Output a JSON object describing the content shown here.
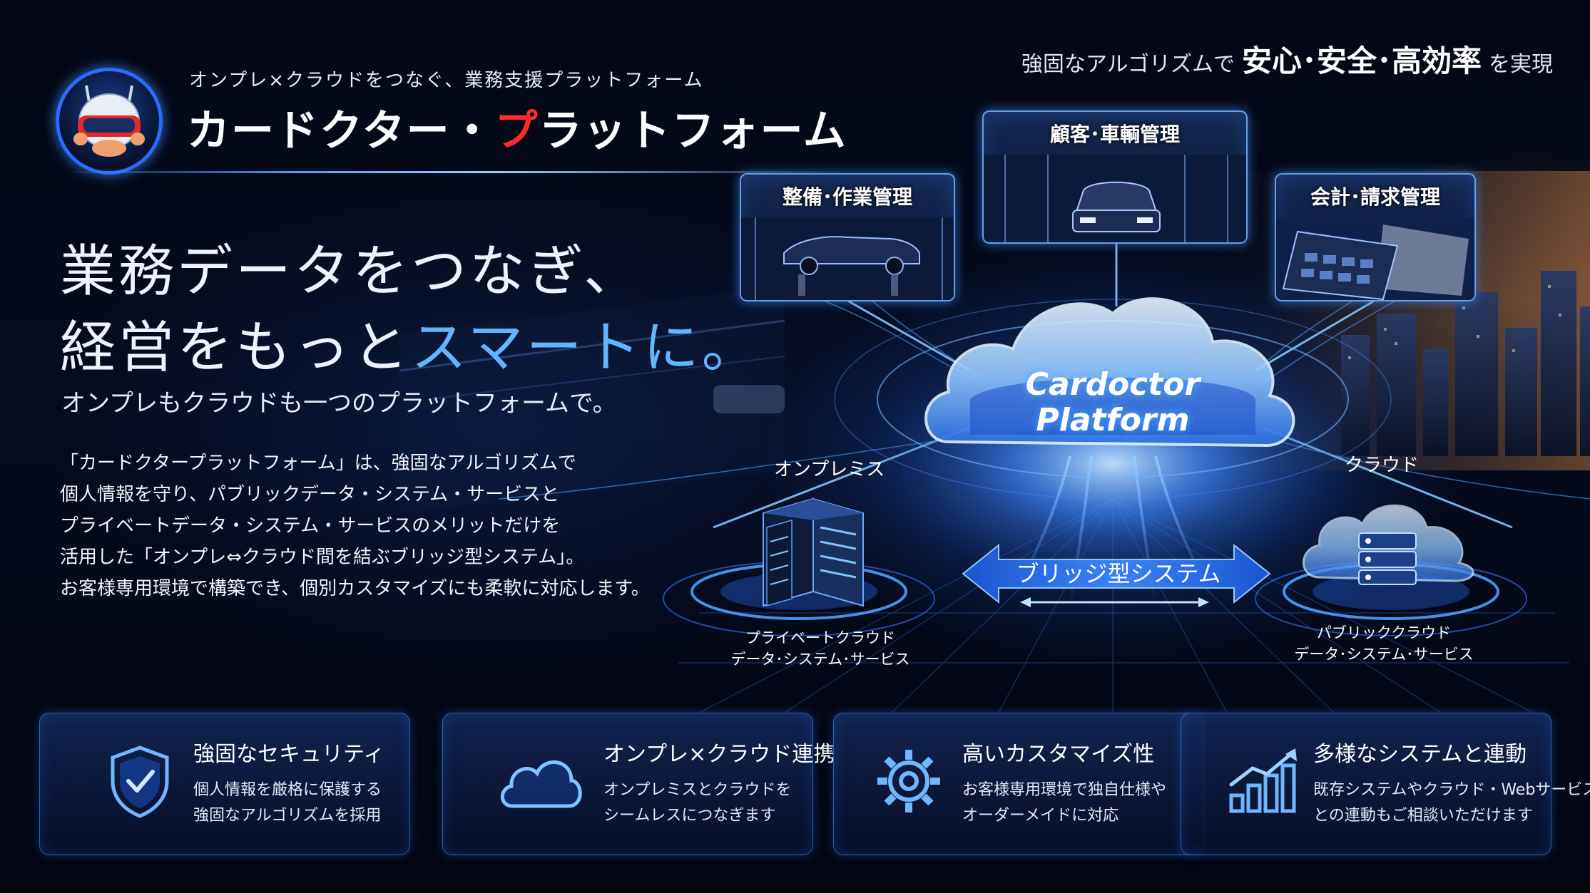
{
  "header": {
    "tagline": "オンプレ×クラウドをつなぐ、業務支援プラットフォーム",
    "brand_part1": "カードクター・",
    "brand_red": "プ",
    "brand_part2": "ラットフォーム",
    "top_right_prefix": "強固なアルゴリズムで",
    "top_right_emph": "安心･安全･高効率",
    "top_right_suffix": "を実現"
  },
  "hero": {
    "line1": "業務データをつなぎ、",
    "line2_prefix": "経営をもっと",
    "line2_highlight": "スマートに。",
    "subtitle": "オンプレもクラウドも一つのプラットフォームで。",
    "body_lines": [
      "「カードクタープラットフォーム」は、強固なアルゴリズムで",
      "個人情報を守り、パブリックデータ・システム・サービスと",
      "プライベートデータ・システム・サービスのメリットだけを",
      "活用した「オンプレ⇔クラウド間を結ぶブリッジ型システム」。",
      "お客様専用環境で構築でき、個別カスタマイズにも柔軟に対応します。"
    ]
  },
  "diagram": {
    "panel_maintenance": "整備･作業管理",
    "panel_customer": "顧客･車輌管理",
    "panel_accounting": "会計･請求管理",
    "cloud_line1": "Cardoctor",
    "cloud_line2": "Platform",
    "onpremise_label": "オンプレミス",
    "cloud_label": "クラウド",
    "bridge_label": "ブリッジ型システム",
    "private_caption_line1": "プライベートクラウド",
    "private_caption_line2": "データ･システム･サービス",
    "public_caption_line1": "パブリッククラウド",
    "public_caption_line2": "データ･システム･サービス"
  },
  "features": [
    {
      "icon": "shield-check-icon",
      "title": "強固なセキュリティ",
      "desc1": "個人情報を厳格に保護する",
      "desc2": "強固なアルゴリズムを採用"
    },
    {
      "icon": "cloud-icon",
      "title": "オンプレ×クラウド連携",
      "desc1": "オンプレミスとクラウドを",
      "desc2": "シームレスにつなぎます"
    },
    {
      "icon": "gear-icon",
      "title": "高いカスタマイズ性",
      "desc1": "お客様専用環境で独自仕様や",
      "desc2": "オーダーメイドに対応"
    },
    {
      "icon": "growth-chart-icon",
      "title": "多様なシステムと連動",
      "desc1": "既存システムやクラウド・Webサービス",
      "desc2": "との連動もご相談いただけます"
    }
  ],
  "colors": {
    "accent_blue": "#4f9bff",
    "highlight_blue": "#5fb6ff",
    "brand_red": "#ff2a2a",
    "background": "#03060f"
  }
}
